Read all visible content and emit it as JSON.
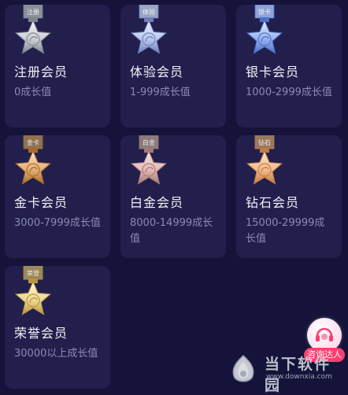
{
  "tiers": [
    {
      "ribbon": "注册",
      "name": "注册会员",
      "range": "0成长值",
      "palette": "silver"
    },
    {
      "ribbon": "体验",
      "name": "体验会员",
      "range": "1-999成长值",
      "palette": "lightblue"
    },
    {
      "ribbon": "银卡",
      "name": "银卡会员",
      "range": "1000-2999成长值",
      "palette": "blue"
    },
    {
      "ribbon": "金卡",
      "name": "金卡会员",
      "range": "3000-7999成长值",
      "palette": "bronze"
    },
    {
      "ribbon": "白金",
      "name": "白金会员",
      "range": "8000-14999成长值",
      "palette": "rose"
    },
    {
      "ribbon": "钻石",
      "name": "钻石会员",
      "range": "15000-29999成长值",
      "palette": "peach"
    },
    {
      "ribbon": "荣誉",
      "name": "荣誉会员",
      "range": "30000以上成长值",
      "palette": "gold"
    }
  ],
  "consult": {
    "label": "咨询达人"
  },
  "watermark": {
    "title": "当下软件园",
    "url": "www.downxia.com"
  },
  "colors": {
    "background": "#15133a",
    "card": "#221f4c",
    "consult_badge": "#ff3d71"
  }
}
